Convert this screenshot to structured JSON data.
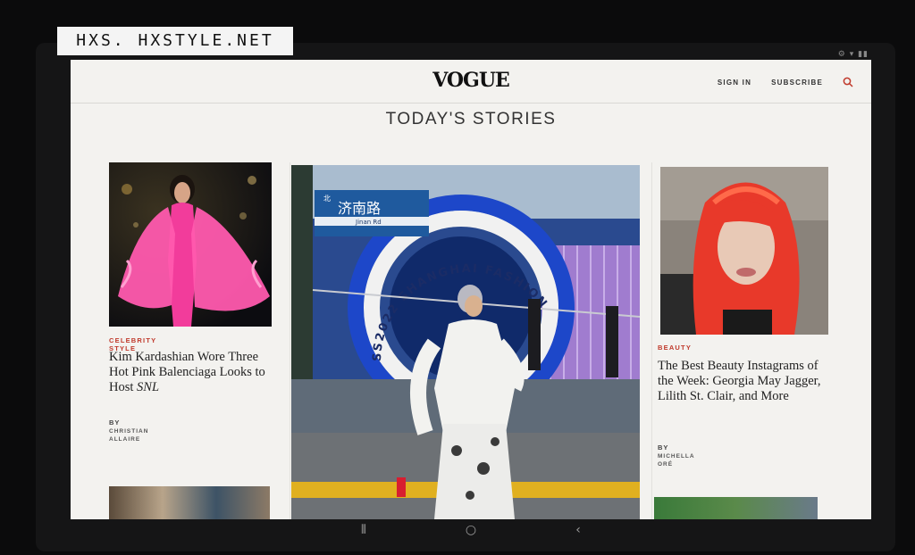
{
  "watermark": {
    "text": "HXS. HXSTYLE.NET"
  },
  "status": {
    "icons": "⚙ ▾ ▮▮"
  },
  "header": {
    "logo": "VOGUE",
    "sign_in": "SIGN IN",
    "subscribe": "SUBSCRIBE"
  },
  "section": {
    "title": "TODAY'S STORIES"
  },
  "stories": [
    {
      "kicker": "CELEBRITY STYLE",
      "headline_main": "Kim Kardashian Wore Three Hot Pink Balenciaga Looks to Host ",
      "headline_italic": "SNL",
      "by": "BY",
      "author": "CHRISTIAN ALLAIRE"
    },
    {
      "sign_cn": "济南路",
      "sign_en": "Jinan Rd",
      "sign_dir": "北",
      "arch_text": "SS2022 SHANGHAI FASHION"
    },
    {
      "kicker": "BEAUTY",
      "headline": "The Best Beauty Instagrams of the Week: Georgia May Jagger, Lilith St. Clair, and More",
      "by": "BY",
      "author": "MICHELLA ORÉ"
    }
  ],
  "nav": {
    "recent": "⦀",
    "home": "○",
    "back": "‹"
  },
  "colors": {
    "kicker": "#c0392b",
    "page_bg": "#f3f2ef",
    "pink": "#f23c9b",
    "hair": "#e8392a"
  }
}
